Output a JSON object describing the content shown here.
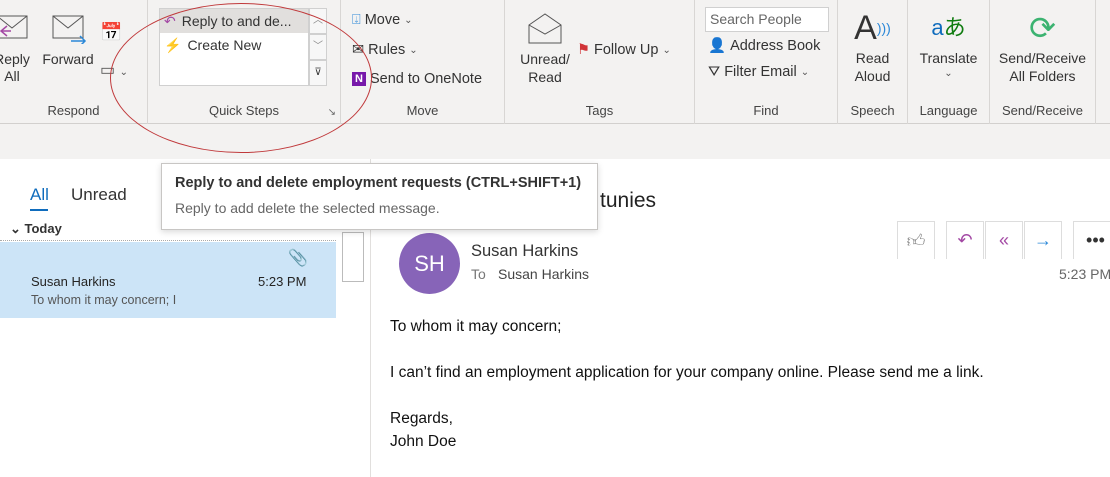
{
  "ribbon": {
    "respond": {
      "reply_all": "Reply\nAll",
      "reply_all_l1": "Reply",
      "reply_all_l2": "All",
      "forward": "Forward",
      "label": "Respond"
    },
    "quick_steps": {
      "items": [
        "Reply to and de...",
        "Create New"
      ],
      "label": "Quick Steps"
    },
    "move": {
      "move": "Move",
      "rules": "Rules",
      "onenote": "Send to OneNote",
      "label": "Move"
    },
    "tags": {
      "unread_l1": "Unread/",
      "unread_l2": "Read",
      "follow_up": "Follow Up",
      "label": "Tags"
    },
    "find": {
      "search_placeholder": "Search People",
      "address_book": "Address Book",
      "filter_email": "Filter Email",
      "label": "Find"
    },
    "speech": {
      "l1": "Read",
      "l2": "Aloud",
      "label": "Speech"
    },
    "language": {
      "translate": "Translate",
      "label": "Language"
    },
    "send_receive": {
      "l1": "Send/Receive",
      "l2": "All Folders",
      "label": "Send/Receive"
    }
  },
  "tooltip": {
    "title": "Reply to and delete employment requests (CTRL+SHIFT+1)",
    "desc": "Reply to add delete the selected message."
  },
  "list": {
    "tabs": [
      "All",
      "Unread"
    ],
    "group": "Today",
    "items": [
      {
        "sender": "Susan Harkins",
        "time": "5:23 PM",
        "preview": "To whom it may concern;  I"
      }
    ]
  },
  "reading": {
    "subject_tail": "tunies",
    "initials": "SH",
    "from": "Susan Harkins",
    "to_label": "To",
    "to": "Susan Harkins",
    "time": "5:23 PM",
    "body": [
      "To whom it may concern;",
      "I can’t find an employment application for your company online. Please send me a link.",
      "Regards,",
      "John Doe"
    ]
  },
  "colors": {
    "accent": "#0f6cbd",
    "selected": "#cce4f7",
    "avatar": "#8764b8",
    "annotation": "#c0393b"
  }
}
